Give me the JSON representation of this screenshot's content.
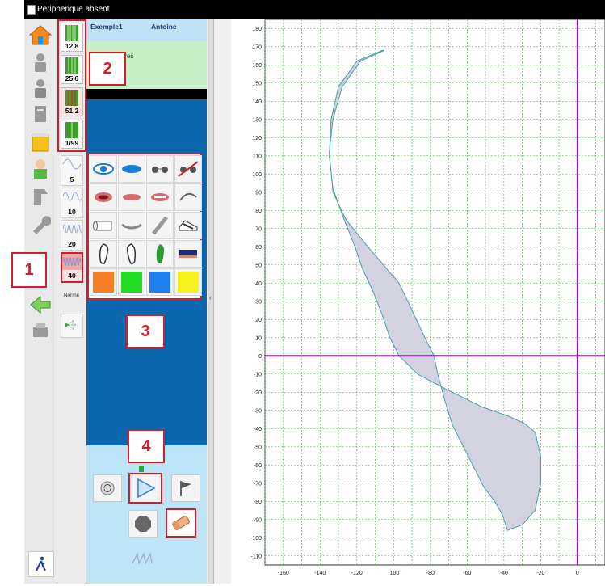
{
  "window": {
    "title": "Peripherique absent"
  },
  "header": {
    "col1": "Exemple1",
    "col2": "Antoine"
  },
  "notes": {
    "label": "Auxiliaires"
  },
  "zoom_buttons": [
    "12,8",
    "25,6",
    "51,2",
    "1/99"
  ],
  "wave_buttons": [
    "5",
    "10",
    "20",
    "40"
  ],
  "norme_label": "Norme",
  "callouts": [
    "1",
    "2",
    "3",
    "4"
  ],
  "palette_colors": [
    "#f77f27",
    "#22dd22",
    "#1f7ff0",
    "#f7f21c"
  ],
  "chart_data": {
    "type": "area",
    "title": "",
    "xlabel": "",
    "ylabel": "",
    "xlim": [
      -170,
      15
    ],
    "ylim": [
      -115,
      185
    ],
    "x_ticks": [
      -160,
      -140,
      -120,
      -100,
      -80,
      -60,
      -40,
      -20,
      0
    ],
    "y_ticks": [
      180,
      170,
      160,
      150,
      140,
      130,
      120,
      110,
      100,
      90,
      80,
      70,
      60,
      50,
      40,
      30,
      20,
      10,
      0,
      -10,
      -20,
      -30,
      -40,
      -50,
      -60,
      -70,
      -80,
      -90,
      -100,
      -110
    ],
    "grid": true,
    "axes_lines": {
      "x": 0,
      "y": 0,
      "color": "#8b1a9e"
    },
    "series": [
      {
        "fill": "#d2d2e0",
        "stroke": "#4a9fa6",
        "x": [
          -105,
          -118,
          -128,
          -133,
          -135,
          -133,
          -126,
          -114,
          -97,
          -90,
          -83,
          -78,
          -76,
          -72,
          -68,
          -63,
          -57,
          -51,
          -45,
          -41,
          -39,
          -38,
          -36,
          -30,
          -23,
          -20,
          -20,
          -23,
          -29,
          -38,
          -52,
          -72,
          -87,
          -97,
          -102,
          -106,
          -111,
          -117,
          -121,
          -127,
          -133,
          -135,
          -134,
          -130,
          -120,
          -106
        ],
        "y": [
          168,
          162,
          148,
          130,
          112,
          90,
          75,
          60,
          40,
          25,
          10,
          0,
          -10,
          -25,
          -38,
          -48,
          -60,
          -72,
          -80,
          -87,
          -93,
          -96,
          -95,
          -93,
          -85,
          -70,
          -55,
          -42,
          -37,
          -33,
          -28,
          -18,
          -10,
          0,
          10,
          22,
          35,
          48,
          60,
          75,
          92,
          110,
          130,
          148,
          162,
          168
        ]
      }
    ]
  }
}
